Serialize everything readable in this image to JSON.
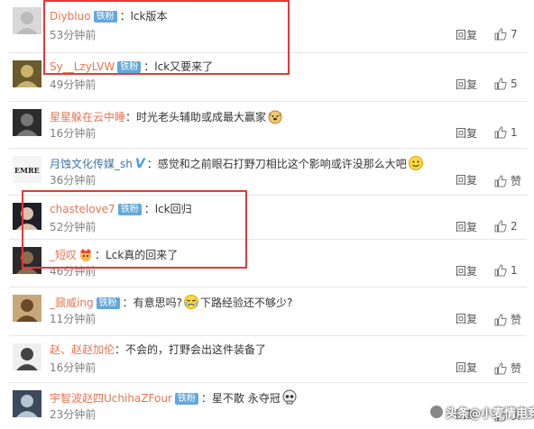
{
  "reply_label": "回复",
  "like_label_default": "赞",
  "badge_text": "铁粉",
  "comments": [
    {
      "user": "Diybluo",
      "badge": true,
      "verified": false,
      "text": "lck版本",
      "time": "53分钟前",
      "likes": "7",
      "emoji": null,
      "name_color": "#eb7350"
    },
    {
      "user": "Sy__LzyLVW",
      "badge": true,
      "verified": false,
      "text": "lck又要来了",
      "time": "49分钟前",
      "likes": "5",
      "emoji": null,
      "name_color": "#eb7350"
    },
    {
      "user": "星星躲在云中睡",
      "badge": false,
      "verified": false,
      "text": "时光老头辅助或成最大赢家",
      "time": "16分钟前",
      "likes": "1",
      "emoji": "dog-emoji",
      "name_color": "#eb7350"
    },
    {
      "user": "月蚀文化传媒_sh",
      "badge": false,
      "verified": true,
      "text": "感觉和之前眼石打野刀相比这个影响或许没那么大吧",
      "time": "36分钟前",
      "likes": "",
      "emoji": "smile-emoji",
      "name_color": "#3f73a8"
    },
    {
      "user": "chastelove7",
      "badge": true,
      "verified": false,
      "text": "lck回归",
      "time": "52分钟前",
      "likes": "2",
      "emoji": null,
      "name_color": "#eb7350"
    },
    {
      "user": "_短叹",
      "badge": false,
      "verified": false,
      "text": "Lck真的回来了",
      "time": "46分钟前",
      "likes": "1",
      "emoji": "crown-emoji",
      "name_color": "#eb7350"
    },
    {
      "user": "_鼐威ing",
      "badge": true,
      "verified": false,
      "text": "有意思吗?",
      "text2": "下路经验还不够少?",
      "time": "11分钟前",
      "likes": "",
      "emoji": "cry-emoji",
      "name_color": "#eb7350"
    },
    {
      "user": "赵、赵赵加伦",
      "badge": false,
      "verified": false,
      "text": "不会的，打野会出这件装备了",
      "time": "16分钟前",
      "likes": "",
      "emoji": null,
      "name_color": "#eb7350"
    },
    {
      "user": "宇智波赵四UchihaZFour",
      "badge": true,
      "verified": false,
      "text": "星不散 永夺冠",
      "time": "23分钟前",
      "likes": "",
      "emoji": "skull-emoji",
      "name_color": "#eb7350"
    }
  ],
  "watermark": "头条@小麦情电竞",
  "colors": {
    "accent_name": "#eb7350",
    "badge": "#62a8d9",
    "highlight_box": "#e53935",
    "divider": "#e6e6e6"
  }
}
